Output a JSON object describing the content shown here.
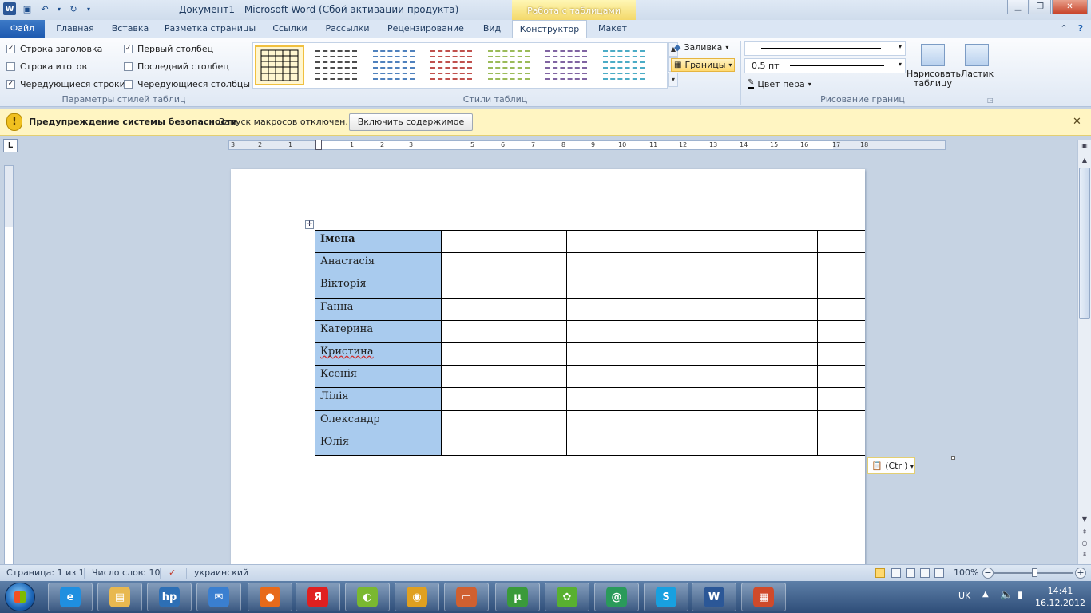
{
  "window": {
    "title": "Документ1  -  Microsoft Word (Сбой активации продукта)",
    "context_tab_group": "Работа с таблицами"
  },
  "tabs": [
    "Файл",
    "Главная",
    "Вставка",
    "Разметка страницы",
    "Ссылки",
    "Рассылки",
    "Рецензирование",
    "Вид",
    "Конструктор",
    "Макет"
  ],
  "ribbon": {
    "style_options": {
      "label": "Параметры стилей таблиц",
      "items": [
        {
          "label": "Строка заголовка",
          "checked": true
        },
        {
          "label": "Строка итогов",
          "checked": false
        },
        {
          "label": "Чередующиеся строки",
          "checked": true
        },
        {
          "label": "Первый столбец",
          "checked": true
        },
        {
          "label": "Последний столбец",
          "checked": false
        },
        {
          "label": "Чередующиеся столбцы",
          "checked": false
        }
      ]
    },
    "table_styles": {
      "label": "Стили таблиц",
      "thumb_colors": [
        "#000000",
        "#4d4d4d",
        "#4f81bd",
        "#c0504d",
        "#9bbb59",
        "#8064a2",
        "#4bacc6"
      ],
      "fill_label": "Заливка",
      "borders_label": "Границы"
    },
    "draw_borders": {
      "label": "Рисование границ",
      "pen_weight": "0,5 пт",
      "pen_color_label": "Цвет пера",
      "draw_table_label": "Нарисовать таблицу",
      "eraser_label": "Ластик"
    }
  },
  "message_bar": {
    "title": "Предупреждение системы безопасности",
    "text": "Запуск макросов отключен.",
    "button": "Включить содержимое"
  },
  "ruler": {
    "ticks": [
      "3",
      "2",
      "1",
      "1",
      "2",
      "3",
      "5",
      "6",
      "7",
      "8",
      "9",
      "10",
      "11",
      "12",
      "13",
      "14",
      "15",
      "16",
      "17",
      "18"
    ]
  },
  "table": {
    "rows": [
      "Імена",
      "Анастасія",
      "Вікторія",
      "Ганна",
      "Катерина",
      "Кристина",
      "Ксенія",
      "Лілія",
      "Олександр",
      "Юлія"
    ],
    "first_column_fill": "#a9cbee"
  },
  "paste_options": "(Ctrl)",
  "status_bar": {
    "page": "Страница: 1 из 1",
    "words": "Число слов: 10",
    "language": "украинский",
    "zoom": "100%",
    "zoom_minus": "−",
    "zoom_plus": "+"
  },
  "taskbar": {
    "apps": [
      {
        "icon": "internet-explorer-icon",
        "glyph": "e"
      },
      {
        "icon": "file-explorer-icon",
        "glyph": "▤"
      },
      {
        "icon": "hp-icon",
        "glyph": "hp"
      },
      {
        "icon": "mail-icon",
        "glyph": "✉"
      },
      {
        "icon": "firefox-icon",
        "glyph": "●"
      },
      {
        "icon": "yandex-icon",
        "glyph": "Я"
      },
      {
        "icon": "media-icon",
        "glyph": "◐"
      },
      {
        "icon": "media-player-icon",
        "glyph": "◉"
      },
      {
        "icon": "image-viewer-icon",
        "glyph": "▭"
      },
      {
        "icon": "utorrent-icon",
        "glyph": "µ"
      },
      {
        "icon": "icq-icon",
        "glyph": "✿"
      },
      {
        "icon": "mail-agent-icon",
        "glyph": "@"
      },
      {
        "icon": "skype-icon",
        "glyph": "S"
      },
      {
        "icon": "word-icon",
        "glyph": "W"
      },
      {
        "icon": "paint-icon",
        "glyph": "▦"
      }
    ],
    "language": "UK",
    "time": "14:41",
    "date": "16.12.2012"
  }
}
